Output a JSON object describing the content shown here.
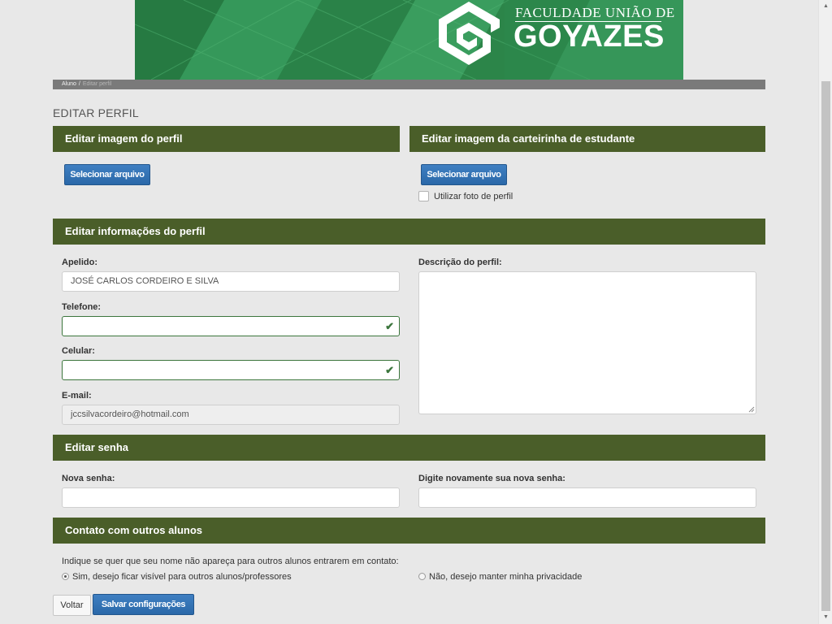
{
  "banner": {
    "brand_top": "FACULDADE UNIÃO DE",
    "brand_main": "GOYAZES"
  },
  "breadcrumb": {
    "items": [
      "Aluno",
      "Editar perfil"
    ],
    "separator": "/"
  },
  "page": {
    "title": "EDITAR PERFIL"
  },
  "profile_image": {
    "heading": "Editar imagem do perfil",
    "button": "Selecionar arquivo"
  },
  "card_image": {
    "heading": "Editar imagem da carteirinha de estudante",
    "button": "Selecionar arquivo",
    "checkbox_label": "Utilizar foto de perfil",
    "checkbox_checked": false
  },
  "profile_info": {
    "heading": "Editar informações do perfil",
    "nickname": {
      "label": "Apelido:",
      "value": "JOSÉ CARLOS CORDEIRO E SILVA"
    },
    "phone": {
      "label": "Telefone:",
      "value": "",
      "status": "valid"
    },
    "mobile": {
      "label": "Celular:",
      "value": "",
      "status": "valid"
    },
    "email": {
      "label": "E-mail:",
      "value": "jccsilvacordeiro@hotmail.com",
      "disabled": true
    },
    "description": {
      "label": "Descrição do perfil:",
      "value": ""
    }
  },
  "password": {
    "heading": "Editar senha",
    "new_label": "Nova senha:",
    "confirm_label": "Digite novamente sua nova senha:"
  },
  "contact": {
    "heading": "Contato com outros alunos",
    "question": "Indique se quer que seu nome não apareça para outros alunos entrarem em contato:",
    "options": [
      {
        "label": "Sim, desejo ficar visível para outros alunos/professores",
        "selected": true
      },
      {
        "label": "Não, desejo manter minha privacidade",
        "selected": false
      }
    ]
  },
  "actions": {
    "back": "Voltar",
    "save": "Salvar configurações"
  },
  "colors": {
    "panel_header": "#4a5e29",
    "primary_button": "#2e6da4",
    "valid_border": "#3c763d",
    "banner": "#2e8a4e"
  }
}
